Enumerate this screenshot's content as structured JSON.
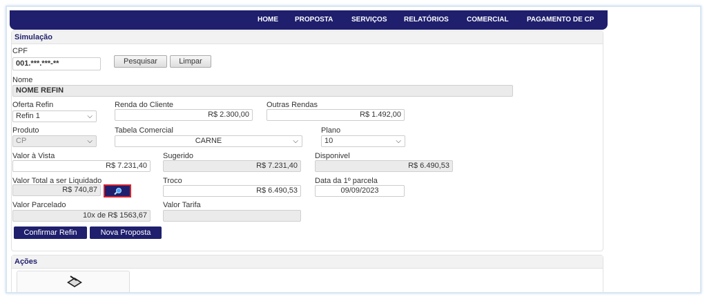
{
  "nav": {
    "items": [
      "HOME",
      "PROPOSTA",
      "SERVIÇOS",
      "RELATÓRIOS",
      "COMERCIAL",
      "PAGAMENTO DE CP"
    ]
  },
  "simulacao": {
    "title": "Simulação",
    "cpf_label": "CPF",
    "cpf_value": "001.***.***-**",
    "pesquisar": "Pesquisar",
    "limpar": "Limpar",
    "nome_label": "Nome",
    "nome_value": "NOME REFIN",
    "oferta_label": "Oferta Refin",
    "oferta_value": "Refin 1",
    "renda_label": "Renda do Cliente",
    "renda_value": "R$ 2.300,00",
    "outras_label": "Outras Rendas",
    "outras_value": "R$ 1.492,00",
    "produto_label": "Produto",
    "produto_value": "CP",
    "tabela_label": "Tabela Comercial",
    "tabela_value": "CARNE",
    "plano_label": "Plano",
    "plano_value": "10",
    "vista_label": "Valor à Vista",
    "vista_value": "R$ 7.231,40",
    "sugerido_label": "Sugerido",
    "sugerido_value": "R$ 7.231,40",
    "disponivel_label": "Disponivel",
    "disponivel_value": "R$ 6.490,53",
    "liquidado_label": "Valor Total a ser Liquidado",
    "liquidado_value": "R$ 740,87",
    "troco_label": "Troco",
    "troco_value": "R$ 6.490,53",
    "data_label": "Data da 1º parcela",
    "data_value": "09/09/2023",
    "parcelado_label": "Valor Parcelado",
    "parcelado_value": "10x de R$ 1563,67",
    "tarifa_label": "Valor Tarifa",
    "tarifa_value": "",
    "confirmar": "Confirmar Refin",
    "nova": "Nova Proposta"
  },
  "acoes": {
    "title": "Ações"
  },
  "icons": {
    "search": "search-icon",
    "scanner": "scanner-icon",
    "chevron": "chevron-down-icon"
  },
  "colors": {
    "navy": "#1f1f6e",
    "highlight": "#d9252f"
  }
}
